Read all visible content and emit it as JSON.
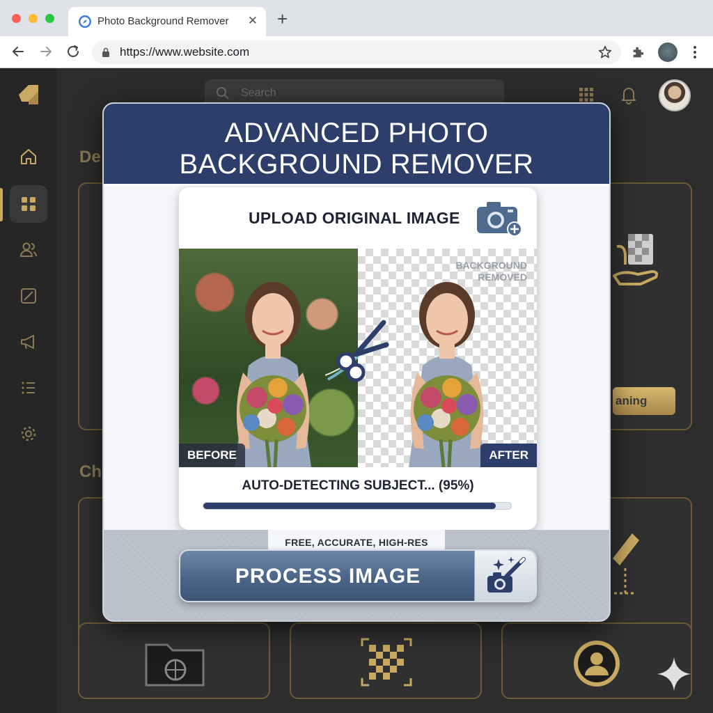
{
  "browser": {
    "tab_title": "Photo Background Remover",
    "url": "https://www.website.com"
  },
  "dashboard": {
    "search_placeholder": "Search",
    "section_1_label": "De",
    "section_2_label": "Ch",
    "card_button_label": "aning"
  },
  "modal": {
    "title_line1": "ADVANCED PHOTO",
    "title_line2": "BACKGROUND REMOVER",
    "upload_label": "UPLOAD ORIGINAL IMAGE",
    "bg_removed_line1": "BACKGROUND",
    "bg_removed_line2": "REMOVED",
    "before_tag": "BEFORE",
    "after_tag": "AFTER",
    "progress_text": "AUTO-DETECTING SUBJECT... (95%)",
    "progress_value": 0.95,
    "footer_pill": "FREE, ACCURATE, HIGH-RES",
    "process_button": "PROCESS IMAGE"
  },
  "colors": {
    "header_navy": "#2e3e6b",
    "accent_gold": "#c9a961",
    "button_blue": "#4b6588"
  },
  "icons": [
    "camera-plus-icon",
    "scissors-icon",
    "magic-camera-icon",
    "lock-icon",
    "star-icon",
    "extensions-icon",
    "bell-icon",
    "grid-icon",
    "home-icon",
    "dashboard-icon",
    "users-icon",
    "image-icon",
    "megaphone-icon",
    "list-icon",
    "settings-icon",
    "sparkle-icon"
  ]
}
